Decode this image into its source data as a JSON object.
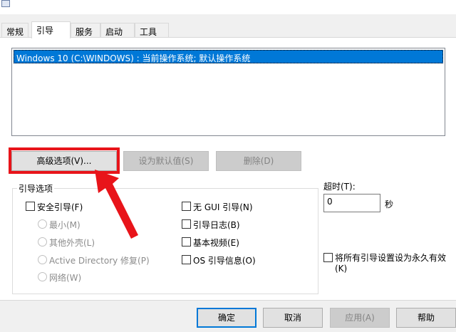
{
  "tabs": [
    "常规",
    "引导",
    "服务",
    "启动",
    "工具"
  ],
  "active_tab": 1,
  "boot_list": [
    "Windows 10 (C:\\WINDOWS) : 当前操作系统; 默认操作系统"
  ],
  "buttons": {
    "advanced": "高级选项(V)...",
    "set_default": "设为默认值(S)",
    "delete": "删除(D)",
    "ok": "确定",
    "cancel": "取消",
    "apply": "应用(A)",
    "help": "帮助"
  },
  "boot_options": {
    "title": "引导选项",
    "safe_boot": "安全引导(F)",
    "minimal": "最小(M)",
    "alt_shell": "其他外壳(L)",
    "ad_repair": "Active Directory 修复(P)",
    "network": "网络(W)",
    "no_gui": "无 GUI 引导(N)",
    "boot_log": "引导日志(B)",
    "base_video": "基本视频(E)",
    "os_info": "OS 引导信息(O)"
  },
  "timeout": {
    "label": "超时(T):",
    "value": "0",
    "unit": "秒"
  },
  "permanent": {
    "label": "将所有引导设置设为永久有效",
    "key": "(K)"
  },
  "colors": {
    "highlight": "#e8141a",
    "selection": "#0078d7"
  }
}
